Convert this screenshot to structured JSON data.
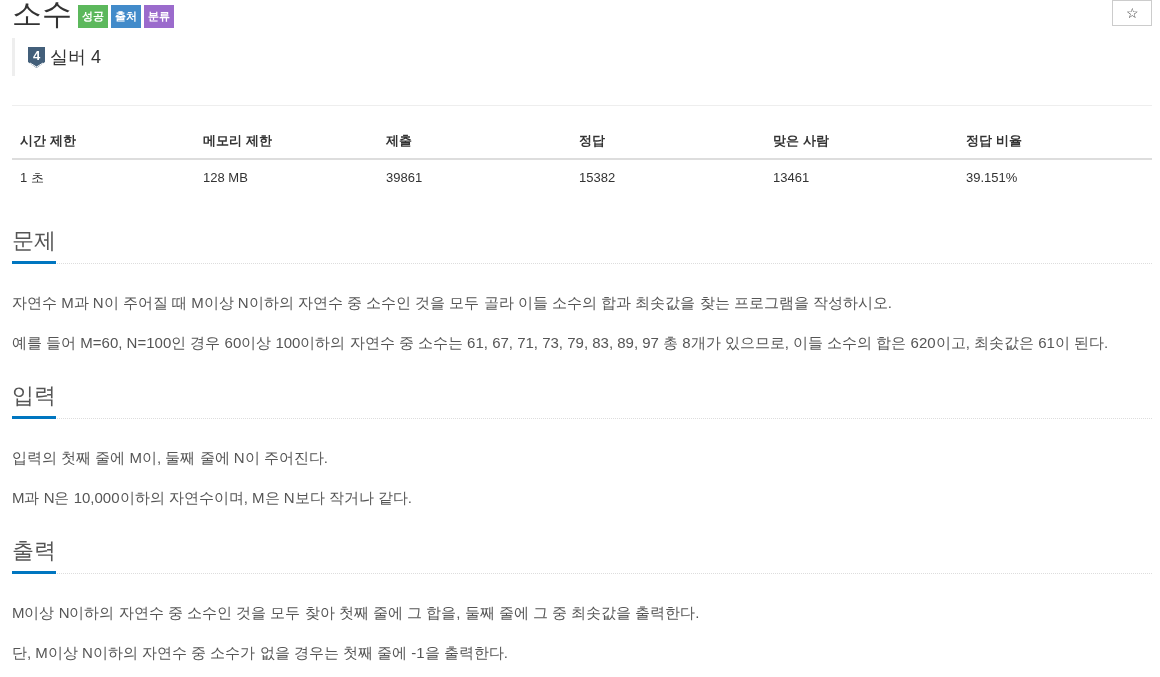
{
  "title": "소수",
  "badges": [
    {
      "label": "성공",
      "color": "#5cb85c"
    },
    {
      "label": "출처",
      "color": "#428bca"
    },
    {
      "label": "분류",
      "color": "#9b6bcc"
    }
  ],
  "favorite_button": {
    "label": "☆"
  },
  "tier": {
    "badge_number": "4",
    "label": "실버 4"
  },
  "stats_table": {
    "columns": [
      "시간 제한",
      "메모리 제한",
      "제출",
      "정답",
      "맞은 사람",
      "정답 비율"
    ],
    "rows": [
      [
        "1 초",
        "128 MB",
        "39861",
        "15382",
        "13461",
        "39.151%"
      ]
    ]
  },
  "sections": [
    {
      "heading": "문제",
      "paragraphs": [
        "자연수 M과 N이 주어질 때 M이상 N이하의 자연수 중 소수인 것을 모두 골라 이들 소수의 합과 최솟값을 찾는 프로그램을 작성하시오.",
        "예를 들어 M=60, N=100인 경우 60이상 100이하의 자연수 중 소수는 61, 67, 71, 73, 79, 83, 89, 97 총 8개가 있으므로, 이들 소수의 합은 620이고, 최솟값은 61이 된다."
      ]
    },
    {
      "heading": "입력",
      "paragraphs": [
        "입력의 첫째 줄에 M이, 둘째 줄에 N이 주어진다.",
        "M과 N은 10,000이하의 자연수이며, M은 N보다 작거나 같다."
      ]
    },
    {
      "heading": "출력",
      "paragraphs": [
        "M이상 N이하의 자연수 중 소수인 것을 모두 찾아 첫째 줄에 그 합을, 둘째 줄에 그 중 최솟값을 출력한다.",
        "단, M이상 N이하의 자연수 중 소수가 없을 경우는 첫째 줄에 -1을 출력한다."
      ]
    }
  ]
}
